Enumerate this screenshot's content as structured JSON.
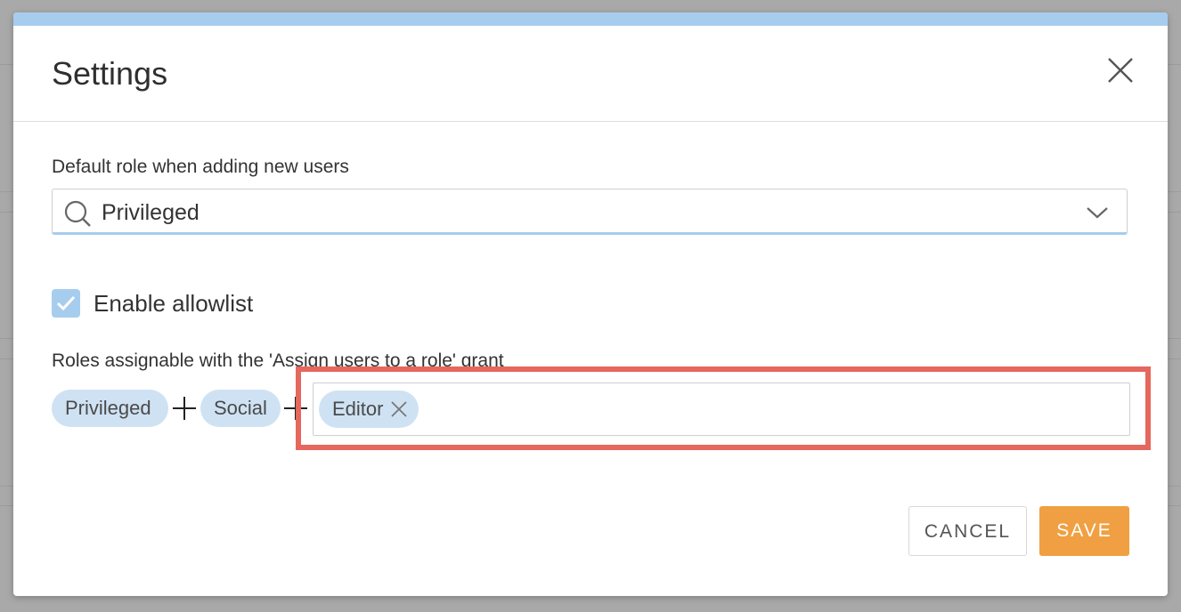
{
  "dialog": {
    "title": "Settings"
  },
  "default_role": {
    "label": "Default role when adding new users",
    "value": "Privileged"
  },
  "allowlist": {
    "label": "Enable allowlist",
    "checked": true
  },
  "roles": {
    "label": "Roles assignable with the 'Assign users to a role' grant",
    "chips": [
      "Privileged",
      "Social"
    ],
    "input_chips": [
      "Editor"
    ]
  },
  "footer": {
    "cancel_label": "CANCEL",
    "save_label": "SAVE"
  },
  "colors": {
    "accent": "#a7cdee",
    "chip": "#cfe2f3",
    "save": "#f0a042",
    "highlight": "#e5675d"
  }
}
